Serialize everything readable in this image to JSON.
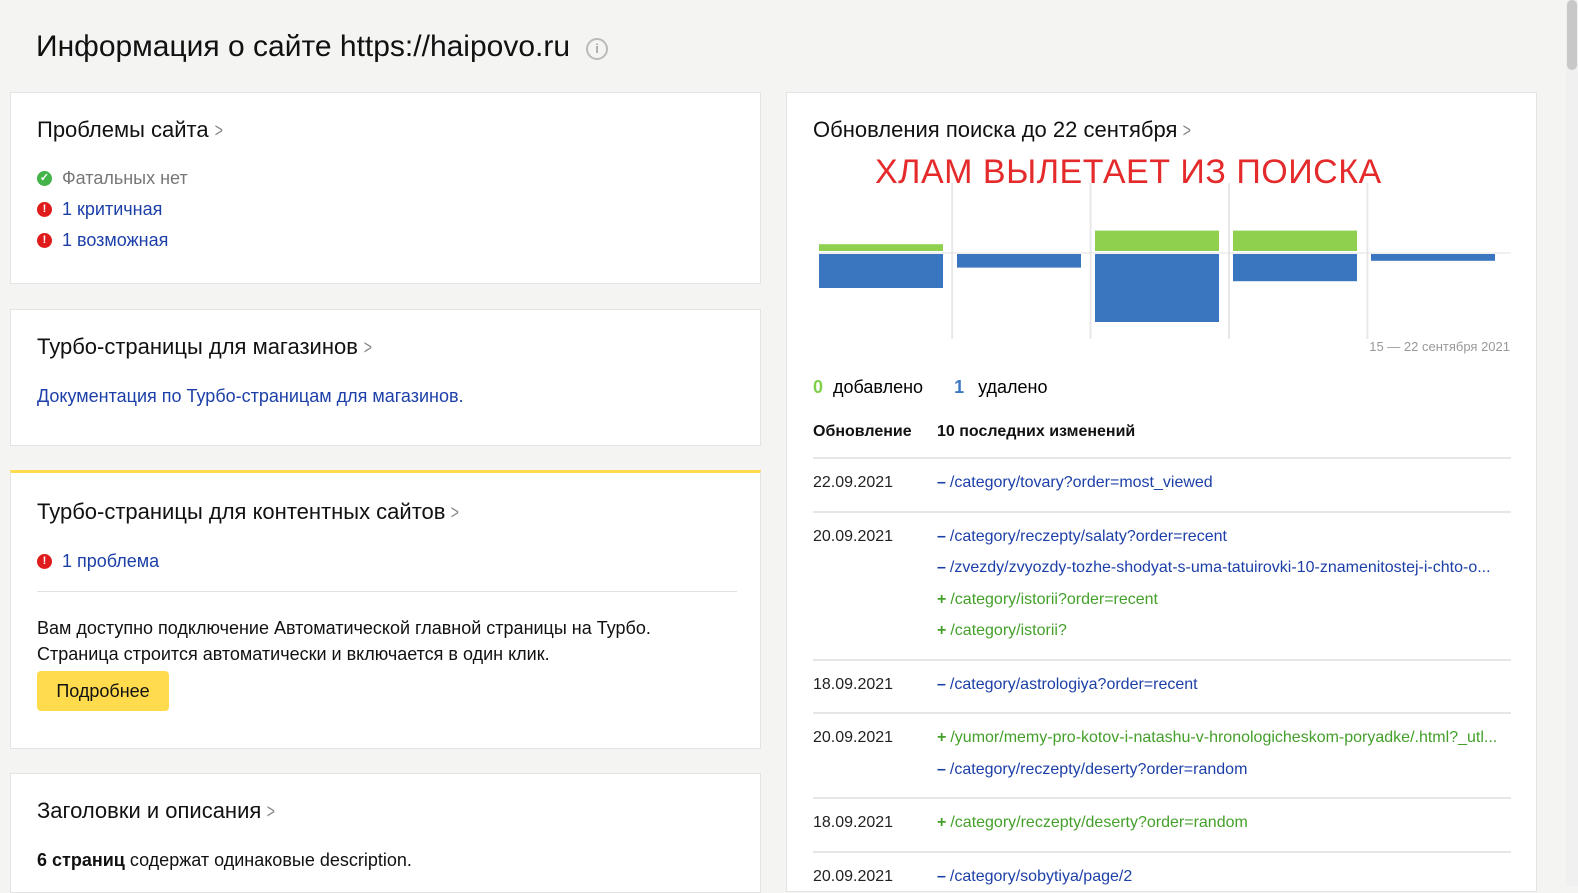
{
  "page": {
    "title": "Информация о сайте https://haipovo.ru"
  },
  "problems": {
    "title": "Проблемы сайта",
    "items": [
      {
        "text": "Фатальных нет",
        "status": "ok"
      },
      {
        "text": "1 критичная",
        "status": "critical"
      },
      {
        "text": "1 возможная",
        "status": "possible"
      }
    ]
  },
  "turbo_shops": {
    "title": "Турбо-страницы для магазинов",
    "doc_link": "Документация по Турбо-страницам для магазинов."
  },
  "turbo_content": {
    "title": "Турбо-страницы для контентных сайтов",
    "problem": "1 проблема",
    "description_line1": "Вам доступно подключение Автоматической главной страницы на Турбо.",
    "description_line2": "Страница строится автоматически и включается в один клик.",
    "button": "Подробнее"
  },
  "headers": {
    "title": "Заголовки и описания",
    "count": "6 страниц",
    "text": " содержат одинаковые description."
  },
  "search_updates": {
    "title": "Обновления поиска до 22 сентября",
    "overlay": "ХЛАМ ВЫЛЕТАЕТ ИЗ ПОИСКА",
    "date_range": "15 — 22 сентября 2021",
    "added_count": "0",
    "added_label": "добавлено",
    "removed_count": "1",
    "removed_label": "удалено",
    "col_update": "Обновление",
    "col_changes": "10 последних изменений",
    "rows": [
      {
        "date": "22.09.2021",
        "changes": [
          {
            "sign": "–",
            "type": "del",
            "url": "/category/tovary?order=most_viewed"
          }
        ]
      },
      {
        "date": "20.09.2021",
        "changes": [
          {
            "sign": "–",
            "type": "del",
            "url": "/category/reczepty/salaty?order=recent"
          },
          {
            "sign": "–",
            "type": "del",
            "url": "/zvezdy/zvyozdy-tozhe-shodyat-s-uma-tatuirovki-10-znamenitostej-i-chto-o..."
          },
          {
            "sign": "+",
            "type": "add",
            "url": "/category/istorii?order=recent"
          },
          {
            "sign": "+",
            "type": "add",
            "url": "/category/istorii?"
          }
        ]
      },
      {
        "date": "18.09.2021",
        "changes": [
          {
            "sign": "–",
            "type": "del",
            "url": "/category/astrologiya?order=recent"
          }
        ]
      },
      {
        "date": "20.09.2021",
        "changes": [
          {
            "sign": "+",
            "type": "add",
            "url": "/yumor/memy-pro-kotov-i-natashu-v-hronologicheskom-poryadke/.html?_utl..."
          },
          {
            "sign": "–",
            "type": "del",
            "url": "/category/reczepty/deserty?order=random"
          }
        ]
      },
      {
        "date": "18.09.2021",
        "changes": [
          {
            "sign": "+",
            "type": "add",
            "url": "/category/reczepty/deserty?order=random"
          }
        ]
      },
      {
        "date": "20.09.2021",
        "changes": [
          {
            "sign": "–",
            "type": "del",
            "url": "/category/sobytiya/page/2"
          }
        ]
      }
    ]
  },
  "chart_data": {
    "type": "bar",
    "series": [
      {
        "name": "добавлено",
        "color": "#8fd14f",
        "values": [
          1,
          0,
          3,
          3,
          0
        ]
      },
      {
        "name": "удалено",
        "color": "#3a76c0",
        "values": [
          5,
          2,
          10,
          4,
          1
        ]
      }
    ]
  }
}
